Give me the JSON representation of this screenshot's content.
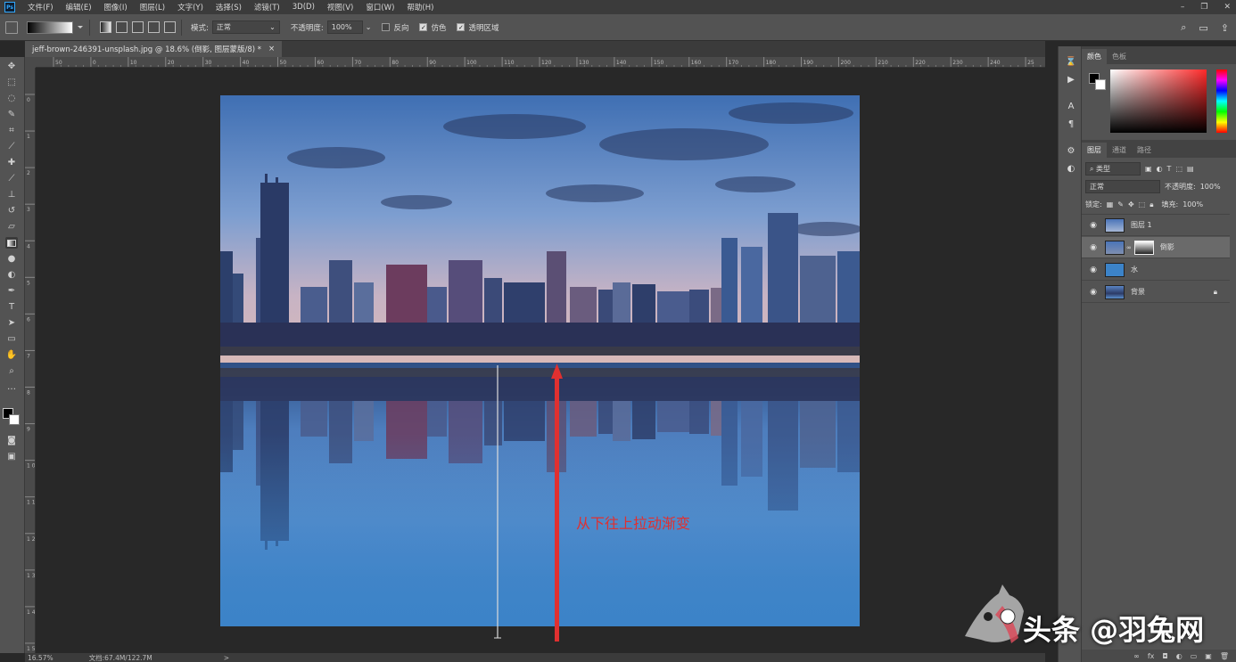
{
  "app": {
    "logo": "Ps"
  },
  "menu": [
    "文件(F)",
    "编辑(E)",
    "图像(I)",
    "图层(L)",
    "文字(Y)",
    "选择(S)",
    "滤镜(T)",
    "3D(D)",
    "视图(V)",
    "窗口(W)",
    "帮助(H)"
  ],
  "window_controls": {
    "minimize": "–",
    "restore": "❐",
    "close": "✕"
  },
  "options": {
    "mode_label": "模式:",
    "mode_value": "正常",
    "opacity_label": "不透明度:",
    "opacity_value": "100%",
    "reverse_label": "反向",
    "reverse_checked": false,
    "dither_label": "仿色",
    "dither_checked": true,
    "transparency_label": "透明区域",
    "transparency_checked": true
  },
  "document": {
    "tab_title": "jeff-brown-246391-unsplash.jpg @ 18.6% (倒影, 图层蒙版/8) *",
    "close": "×"
  },
  "ruler_top": [
    "50",
    "0",
    "10",
    "20",
    "30",
    "40",
    "50",
    "60",
    "70",
    "80",
    "90",
    "100",
    "110",
    "120",
    "130",
    "140",
    "150",
    "160",
    "170",
    "180",
    "190",
    "200",
    "210",
    "220",
    "230",
    "240",
    "25"
  ],
  "ruler_left": [
    "0",
    "1",
    "2",
    "3",
    "4",
    "5",
    "6",
    "7",
    "8",
    "9",
    "1 0",
    "1 1",
    "1 2",
    "1 3",
    "1 4",
    "1 5"
  ],
  "annotation": {
    "text": "从下往上拉动渐变",
    "color": "#e03030"
  },
  "status": {
    "zoom": "16.57%",
    "doc": "文档:67.4M/122.7M",
    "arrow": ">"
  },
  "panels": {
    "color_tabs": [
      "颜色",
      "色板"
    ],
    "layer_tabs": [
      "图层",
      "通道",
      "路径"
    ],
    "filter_kind": "类型",
    "blend_mode": "正常",
    "opacity_label": "不透明度:",
    "opacity_value": "100%",
    "lock_label": "锁定:",
    "fill_label": "填充:",
    "fill_value": "100%",
    "layers": [
      {
        "name": "图层 1",
        "selected": false,
        "thumb": "sky"
      },
      {
        "name": "倒影",
        "selected": true,
        "thumb": "city-mask"
      },
      {
        "name": "水",
        "selected": false,
        "thumb": "blue"
      },
      {
        "name": "背景",
        "selected": false,
        "thumb": "city",
        "locked": true
      }
    ]
  },
  "colors": {
    "accent": "#31a8ff",
    "water": "#3d84c6",
    "annotation_arrow": "#e03030"
  },
  "watermark": {
    "text": "头条 @羽兔网"
  }
}
